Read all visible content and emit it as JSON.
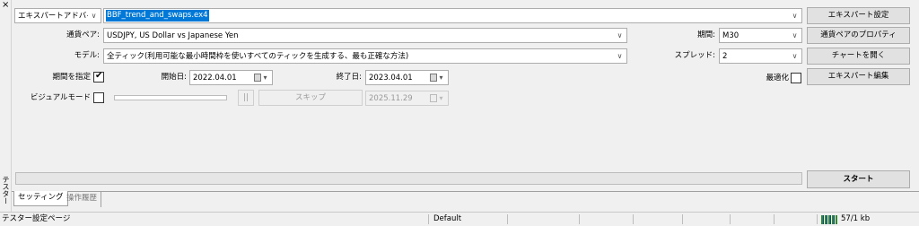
{
  "sidebar": {
    "close_glyph": "×",
    "panel_title": "テスター"
  },
  "expert": {
    "type_value": "エキスパートアドバイザ",
    "file_value": "BBF_trend_and_swaps.ex4",
    "settings_button": "エキスパート設定"
  },
  "symbol": {
    "label": "通貨ペア:",
    "value": "USDJPY, US Dollar vs Japanese Yen",
    "properties_button": "通貨ペアのプロパティ"
  },
  "period": {
    "label": "期間:",
    "value": "M30"
  },
  "model": {
    "label": "モデル:",
    "value": "全ティック(利用可能な最小時間枠を使いすべてのティックを生成する、最も正確な方法)"
  },
  "spread": {
    "label": "スプレッド:",
    "value": "2",
    "open_chart_button": "チャートを開く"
  },
  "dates": {
    "use_date_label": "期間を指定",
    "use_date_checked": true,
    "from_label": "開始日:",
    "from_value": "2022.04.01",
    "to_label": "終了日:",
    "to_value": "2023.04.01"
  },
  "optimization": {
    "label": "最適化",
    "checked": false,
    "edit_expert_button": "エキスパート編集"
  },
  "visual": {
    "label": "ビジュアルモード",
    "checked": false,
    "pause_glyph": "||",
    "skip_button": "スキップ",
    "skip_date": "2025.11.29"
  },
  "run": {
    "start_button": "スタート",
    "progress": 0
  },
  "tabs": [
    {
      "label": "セッティング",
      "active": true
    },
    {
      "label": "操作履歴",
      "active": false
    }
  ],
  "status": {
    "left_text": "テスター設定ページ",
    "profile": "Default",
    "traffic": "57/1 kb"
  }
}
